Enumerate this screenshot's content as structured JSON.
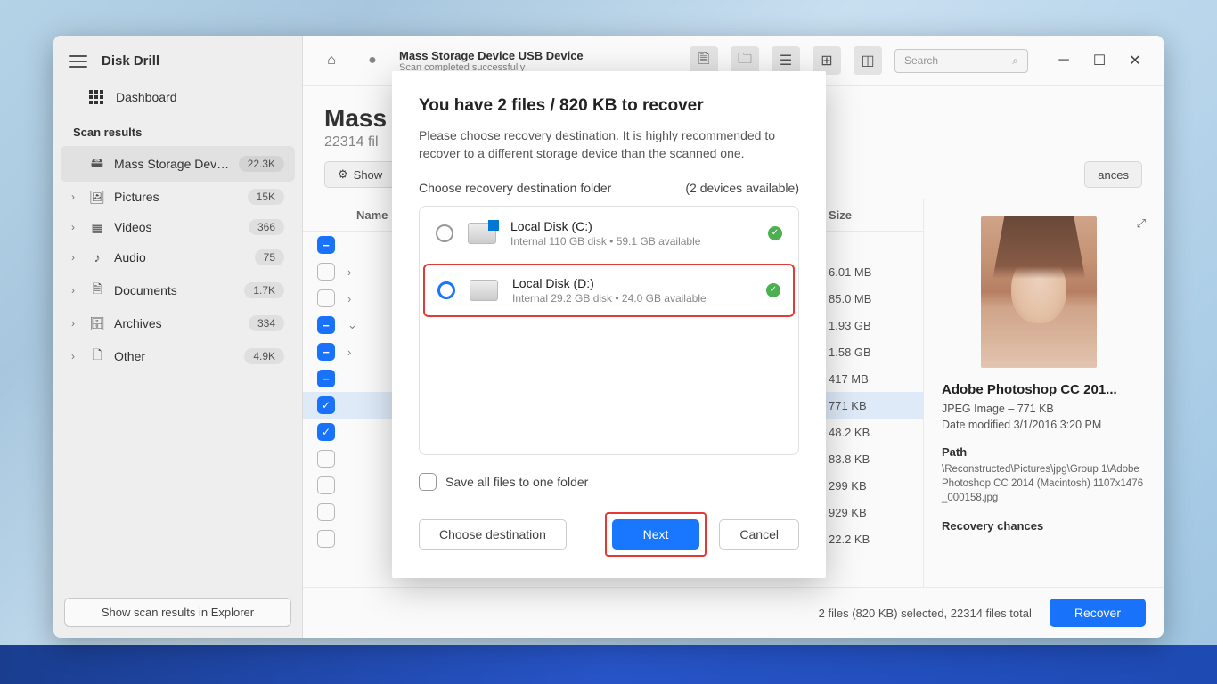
{
  "app": {
    "title": "Disk Drill",
    "dashboard": "Dashboard"
  },
  "sidebar": {
    "section": "Scan results",
    "items": [
      {
        "label": "Mass Storage Device U...",
        "badge": "22.3K",
        "icon": "🖴",
        "active": true,
        "chev": ""
      },
      {
        "label": "Pictures",
        "badge": "15K",
        "icon": "🖼",
        "chev": "›"
      },
      {
        "label": "Videos",
        "badge": "366",
        "icon": "▦",
        "chev": "›"
      },
      {
        "label": "Audio",
        "badge": "75",
        "icon": "♪",
        "chev": "›"
      },
      {
        "label": "Documents",
        "badge": "1.7K",
        "icon": "🗎",
        "chev": "›"
      },
      {
        "label": "Archives",
        "badge": "334",
        "icon": "🗄",
        "chev": "›"
      },
      {
        "label": "Other",
        "badge": "4.9K",
        "icon": "🗋",
        "chev": "›"
      }
    ],
    "footer_btn": "Show scan results in Explorer"
  },
  "topbar": {
    "title": "Mass Storage Device USB Device",
    "subtitle": "Scan completed successfully",
    "search": "Search"
  },
  "header": {
    "big_title": "Mass ",
    "sub_count": "22314 fil"
  },
  "filters": {
    "show": "Show",
    "chances": "ances"
  },
  "columns": {
    "name": "Name",
    "size": "Size"
  },
  "files": [
    {
      "chk": "blue",
      "expand": "",
      "size": ""
    },
    {
      "chk": "empty",
      "expand": "›",
      "size": "6.01 MB"
    },
    {
      "chk": "empty",
      "expand": "›",
      "size": "85.0 MB"
    },
    {
      "chk": "blue",
      "expand": "⌄",
      "size": "1.93 GB"
    },
    {
      "chk": "blue",
      "expand": "›",
      "size": "1.58 GB"
    },
    {
      "chk": "blue",
      "expand": "",
      "size": "417 MB"
    },
    {
      "chk": "check",
      "expand": "",
      "size": "771 KB",
      "sel": true
    },
    {
      "chk": "check",
      "expand": "",
      "size": "48.2 KB"
    },
    {
      "chk": "empty",
      "expand": "",
      "size": "83.8 KB"
    },
    {
      "chk": "empty",
      "expand": "",
      "size": "299 KB"
    },
    {
      "chk": "empty",
      "expand": "",
      "size": "929 KB"
    },
    {
      "chk": "empty",
      "expand": "",
      "size": "22.2 KB"
    }
  ],
  "details": {
    "title": "Adobe Photoshop CC 201...",
    "type_line": "JPEG Image – 771 KB",
    "date_line": "Date modified 3/1/2016 3:20 PM",
    "path_label": "Path",
    "path": "\\Reconstructed\\Pictures\\jpg\\Group 1\\Adobe Photoshop CC 2014 (Macintosh) 1107x1476_000158.jpg",
    "chances_label": "Recovery chances"
  },
  "statusbar": {
    "text": "2 files (820 KB) selected, 22314 files total",
    "recover": "Recover"
  },
  "modal": {
    "title": "You have 2 files / 820 KB to recover",
    "desc": "Please choose recovery destination. It is highly recommended to recover to a different storage device than the scanned one.",
    "dest_label": "Choose recovery destination folder",
    "devices_count": "(2 devices available)",
    "destinations": [
      {
        "name": "Local Disk (C:)",
        "sub": "Internal 110 GB disk • 59.1 GB available",
        "selected": false,
        "win": true
      },
      {
        "name": "Local Disk (D:)",
        "sub": "Internal 29.2 GB disk • 24.0 GB available",
        "selected": true,
        "win": false,
        "highlighted": true
      }
    ],
    "save_all": "Save all files to one folder",
    "choose": "Choose destination",
    "next": "Next",
    "cancel": "Cancel"
  }
}
